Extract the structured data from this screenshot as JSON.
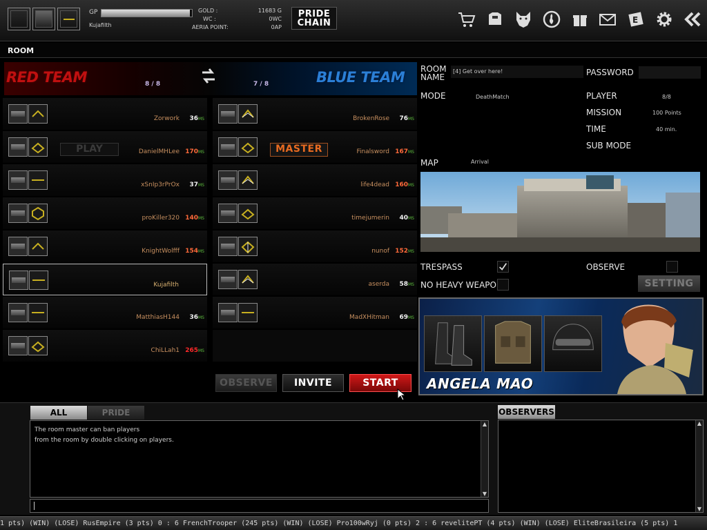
{
  "topbar": {
    "player_name": "Kujafilth",
    "gp_label": "GP",
    "gp_fill": 0.98,
    "gold_label": "GOLD :",
    "wc_label": "WC :",
    "aeria_label": "AERIA POINT:",
    "gold_value": "11683 G",
    "wc_value": "0WC",
    "aeria_value": "0AP",
    "pride_chain_line1": "PRIDE",
    "pride_chain_line2": "CHAIN",
    "icons": [
      "shop-cart-icon",
      "inventory-icon",
      "clan-wolf-icon",
      "emblem-icon",
      "gift-icon",
      "mail-icon",
      "exchange-icon",
      "settings-gear-icon",
      "back-arrow-icon"
    ]
  },
  "room": {
    "header": "ROOM",
    "red_team": {
      "name": "RED TEAM",
      "count": "8 / 8"
    },
    "blue_team": {
      "name": "BLUE TEAM",
      "count": "7 / 8"
    },
    "red_players": [
      {
        "name": "Zorwork",
        "ping": "36",
        "ping_color": "#f0f0f0",
        "rank": "chevron"
      },
      {
        "name": "DanielMHLee",
        "ping": "170",
        "ping_color": "#ff6a3a",
        "rank": "leaf",
        "tag": "PLAY"
      },
      {
        "name": "xSnIp3rPrOx",
        "ping": "37",
        "ping_color": "#f0f0f0",
        "rank": "bar"
      },
      {
        "name": "proKiller320",
        "ping": "140",
        "ping_color": "#ff6a3a",
        "rank": "hex"
      },
      {
        "name": "KnightWolfff",
        "ping": "154",
        "ping_color": "#ff6a3a",
        "rank": "chevron"
      },
      {
        "name": "Kujafilth",
        "ping": "",
        "ping_color": "#f0f0f0",
        "rank": "bar",
        "selected": true
      },
      {
        "name": "MatthiasH144",
        "ping": "36",
        "ping_color": "#f0f0f0",
        "rank": "bar"
      },
      {
        "name": "ChiLLah1",
        "ping": "265",
        "ping_color": "#ff2a2a",
        "rank": "leaf"
      }
    ],
    "blue_players": [
      {
        "name": "BrokenRose",
        "ping": "76",
        "ping_color": "#f0f0f0",
        "rank": "wchevron"
      },
      {
        "name": "Finalsword",
        "ping": "167",
        "ping_color": "#ff6a3a",
        "rank": "leaf",
        "tag": "MASTER"
      },
      {
        "name": "life4dead",
        "ping": "160",
        "ping_color": "#ff6a3a",
        "rank": "wchevron"
      },
      {
        "name": "timejumerin",
        "ping": "40",
        "ping_color": "#f0f0f0",
        "rank": "leaf"
      },
      {
        "name": "nunof",
        "ping": "152",
        "ping_color": "#ff6a3a",
        "rank": "leaf2"
      },
      {
        "name": "aserda",
        "ping": "58",
        "ping_color": "#f0f0f0",
        "rank": "wchevron"
      },
      {
        "name": "MadXHitman",
        "ping": "69",
        "ping_color": "#f0f0f0",
        "rank": "bar"
      }
    ],
    "ping_unit": "MS",
    "buttons": {
      "observe": "OBSERVE",
      "invite": "INVITE",
      "start": "START"
    }
  },
  "info": {
    "room_name_label_1": "ROOM",
    "room_name_label_2": "NAME",
    "room_name_value": "[4] Get over here!",
    "password_label": "PASSWORD",
    "mode_label": "MODE",
    "mode_value": "DeathMatch",
    "player_label": "PLAYER",
    "player_value": "8/8",
    "mission_label": "MISSION",
    "mission_value": "100 Points",
    "time_label": "TIME",
    "time_value": "40 min.",
    "submode_label": "SUB MODE",
    "map_label": "MAP",
    "map_value": "Arrival",
    "trespass_label": "TRESPASS",
    "trespass_checked": true,
    "observe_label": "OBSERVE",
    "observe_checked": false,
    "no_heavy_label": "NO HEAVY WEAPON",
    "no_heavy_checked": false,
    "setting_button": "SETTING",
    "character_name": "ANGELA MAO"
  },
  "chat": {
    "tabs": [
      "ALL",
      "PRIDE"
    ],
    "active_tab": "ALL",
    "lines": [
      "The room master can ban players",
      "from the room by double clicking on players."
    ],
    "observers_tab": "OBSERVERS"
  },
  "ticker": "1 pts) (WIN)    (LOSE) RusEmpire (3 pts) 0 : 6 FrenchTrooper (245 pts) (WIN)    (LOSE) Pro100wRyj (0 pts) 2 : 6 revelitePT (4 pts) (WIN)    (LOSE) EliteBrasileira (5 pts) 1"
}
